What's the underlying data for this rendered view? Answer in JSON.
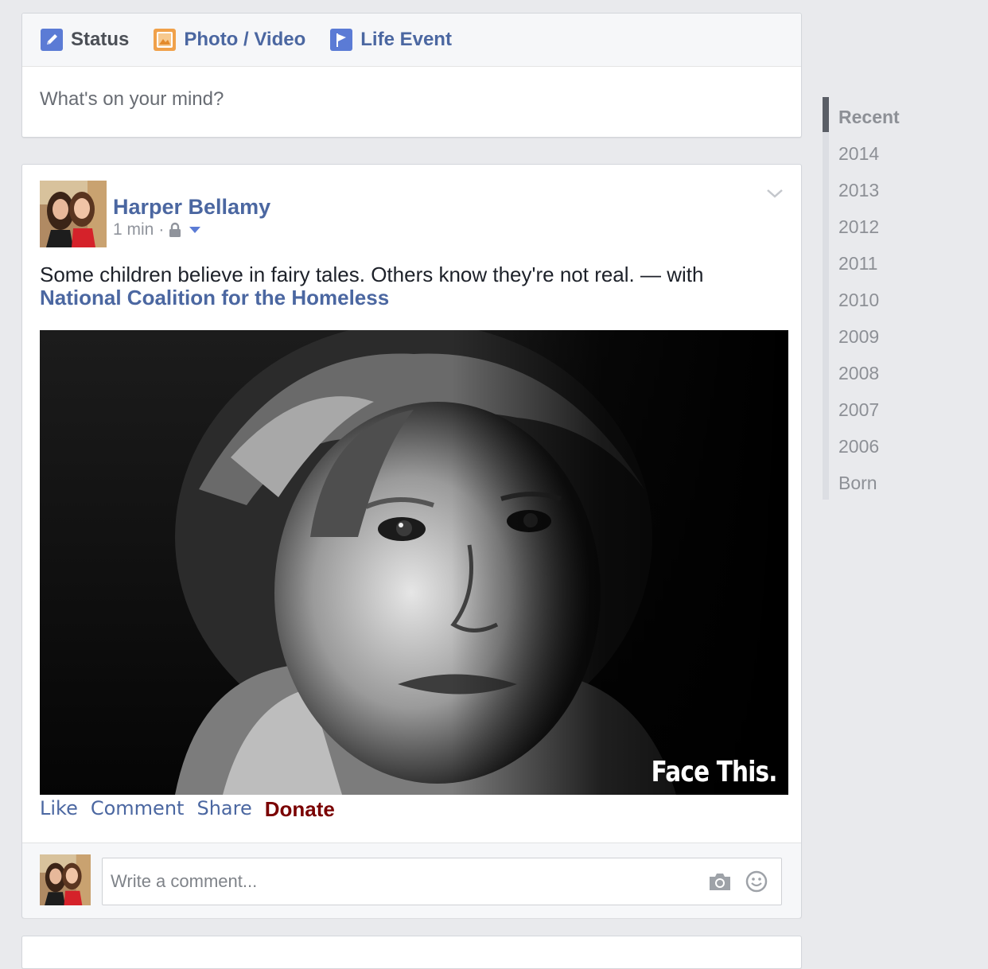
{
  "composer": {
    "tabs": [
      {
        "label": "Status",
        "icon": "pencil-icon"
      },
      {
        "label": "Photo / Video",
        "icon": "photo-icon"
      },
      {
        "label": "Life Event",
        "icon": "flag-icon"
      }
    ],
    "prompt": "What's on your mind?"
  },
  "post": {
    "author": "Harper Bellamy",
    "time": "1 min",
    "separator": "·",
    "text": "Some children believe in fairy tales. Others know they're not real. — with",
    "with_page": "National Coalition for the Homeless",
    "photo_caption": "Face This.",
    "actions": {
      "like": "Like",
      "comment": "Comment",
      "share": "Share",
      "donate": "Donate"
    },
    "comment_placeholder": "Write a comment..."
  },
  "timeline": {
    "items": [
      "Recent",
      "2014",
      "2013",
      "2012",
      "2011",
      "2010",
      "2009",
      "2008",
      "2007",
      "2006",
      "Born"
    ]
  },
  "colors": {
    "link_blue": "#4b67a1",
    "donate_red": "#7a0000",
    "background": "#e9eaed"
  }
}
